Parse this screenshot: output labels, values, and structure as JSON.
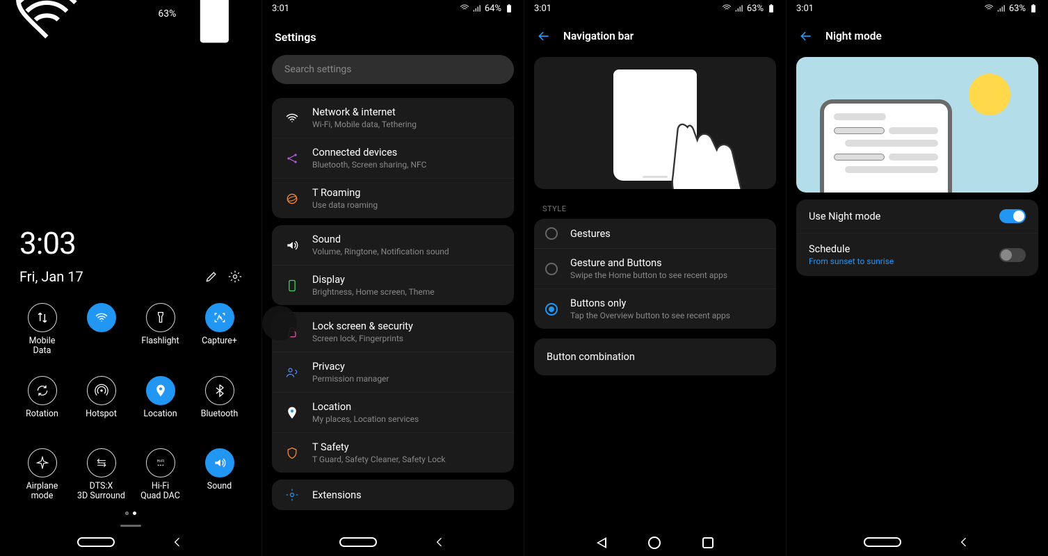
{
  "pane1": {
    "status": {
      "battery": "63%"
    },
    "time": "3:03",
    "date": "Fri, Jan 17",
    "tiles": [
      {
        "label": "Mobile Data",
        "on": false,
        "icon": "mobile-data"
      },
      {
        "label": "",
        "on": true,
        "icon": "wifi"
      },
      {
        "label": "Flashlight",
        "on": false,
        "icon": "flashlight"
      },
      {
        "label": "Capture+",
        "on": true,
        "icon": "capture"
      },
      {
        "label": "Rotation",
        "on": false,
        "icon": "rotation"
      },
      {
        "label": "Hotspot",
        "on": false,
        "icon": "hotspot"
      },
      {
        "label": "Location",
        "on": true,
        "icon": "location"
      },
      {
        "label": "Bluetooth",
        "on": false,
        "icon": "bluetooth"
      },
      {
        "label": "Airplane mode",
        "on": false,
        "icon": "airplane"
      },
      {
        "label": "DTS:X 3D Surround",
        "on": false,
        "icon": "dts"
      },
      {
        "label": "Hi-Fi Quad DAC",
        "on": false,
        "icon": "hifi"
      },
      {
        "label": "Sound",
        "on": true,
        "icon": "sound"
      }
    ]
  },
  "pane2": {
    "status": {
      "time": "3:01",
      "battery": "64%"
    },
    "title": "Settings",
    "search_placeholder": "Search settings",
    "groups": [
      [
        {
          "title": "Network & internet",
          "sub": "Wi-Fi, Mobile data, Tethering",
          "icon": "wifi",
          "color": "#2196f3"
        },
        {
          "title": "Connected devices",
          "sub": "Bluetooth, Screen sharing, NFC",
          "icon": "share",
          "color": "#b45dd6"
        },
        {
          "title": "T Roaming",
          "sub": "Use data roaming",
          "icon": "roaming",
          "color": "#ff8c3b"
        }
      ],
      [
        {
          "title": "Sound",
          "sub": "Volume, Ringtone, Notification sound",
          "icon": "sound",
          "color": "#2196f3"
        },
        {
          "title": "Display",
          "sub": "Brightness, Home screen, Theme",
          "icon": "display",
          "color": "#4cd06a"
        }
      ],
      [
        {
          "title": "Lock screen & security",
          "sub": "Screen lock, Fingerprints",
          "icon": "lock",
          "color": "#e05ba0"
        },
        {
          "title": "Privacy",
          "sub": "Permission manager",
          "icon": "privacy",
          "color": "#5a8cff"
        },
        {
          "title": "Location",
          "sub": "My places, Location services",
          "icon": "location",
          "color": "#b45dd6"
        },
        {
          "title": "T Safety",
          "sub": "T Guard, Safety Cleaner, Safety Lock",
          "icon": "shield",
          "color": "#ff8c3b"
        }
      ],
      [
        {
          "title": "Extensions",
          "sub": "",
          "icon": "ext",
          "color": "#2196f3"
        }
      ]
    ]
  },
  "pane3": {
    "status": {
      "time": "3:01",
      "battery": "63%"
    },
    "title": "Navigation bar",
    "section_label": "STYLE",
    "options": [
      {
        "title": "Gestures",
        "sub": "",
        "selected": false
      },
      {
        "title": "Gesture and Buttons",
        "sub": "Swipe the Home button to see recent apps",
        "selected": false
      },
      {
        "title": "Buttons only",
        "sub": "Tap the Overview button to see recent apps",
        "selected": true
      }
    ],
    "button_combination": "Button combination"
  },
  "pane4": {
    "status": {
      "time": "3:01",
      "battery": "63%"
    },
    "title": "Night mode",
    "rows": [
      {
        "title": "Use Night mode",
        "sub": "",
        "toggle": true
      },
      {
        "title": "Schedule",
        "sub": "From sunset to sunrise",
        "toggle": false
      }
    ]
  }
}
